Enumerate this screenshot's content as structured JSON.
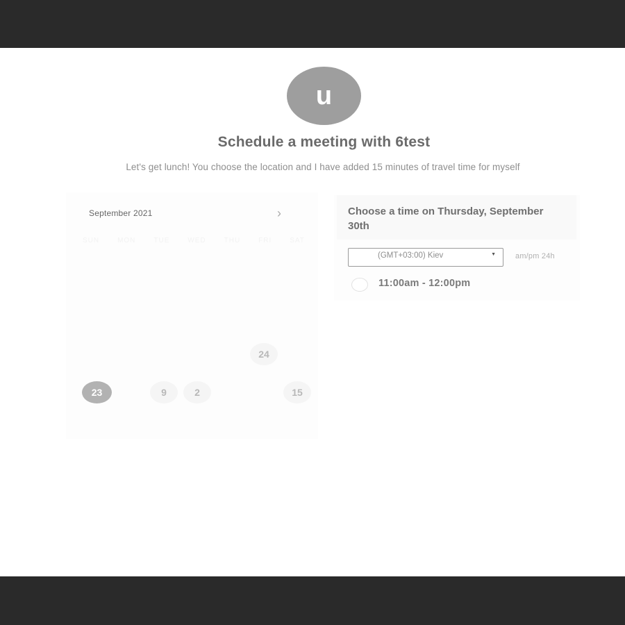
{
  "host": {
    "avatar_initial": "u",
    "title": "Schedule a meeting with 6test",
    "description": "Let's get lunch! You choose the location and I have added 15 minutes of travel time for myself"
  },
  "calendar": {
    "month_label": "September 2021",
    "next_icon": "chevron-right-icon",
    "weekdays": [
      "SUN",
      "MON",
      "TUE",
      "WED",
      "THU",
      "FRI",
      "SAT"
    ],
    "days": {
      "d24": "24",
      "d23": "23",
      "d9": "9",
      "d2": "2",
      "d15": "15"
    },
    "selected_day": "23"
  },
  "time_picker": {
    "heading": "Choose a time on Thursday, September 30th",
    "timezone": "(GMT+03:00) Kiev",
    "format_toggle": "am/pm  24h",
    "slots": [
      {
        "label": "11:00am - 12:00pm"
      }
    ]
  },
  "colors": {
    "frame": "#2a2a2a",
    "avatar_bg": "#9e9e9e",
    "selected_day_bg": "#b2b2b2"
  }
}
